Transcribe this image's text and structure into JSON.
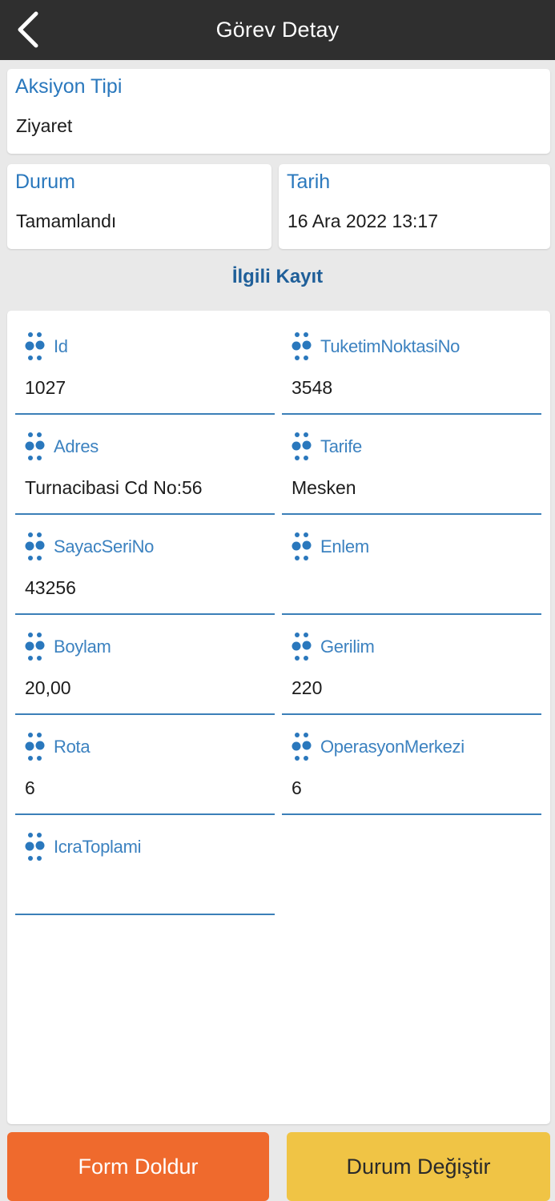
{
  "header": {
    "title": "Görev Detay"
  },
  "aksiyon": {
    "label": "Aksiyon Tipi",
    "value": "Ziyaret"
  },
  "durum": {
    "label": "Durum",
    "value": "Tamamlandı"
  },
  "tarih": {
    "label": "Tarih",
    "value": "16 Ara 2022 13:17"
  },
  "related": {
    "title": "İlgili Kayıt",
    "fields": [
      {
        "label": "Id",
        "value": "1027"
      },
      {
        "label": "TuketimNoktasiNo",
        "value": "3548"
      },
      {
        "label": "Adres",
        "value": "Turnacibasi Cd No:56"
      },
      {
        "label": "Tarife",
        "value": "Mesken"
      },
      {
        "label": "SayacSeriNo",
        "value": "43256"
      },
      {
        "label": "Enlem",
        "value": ""
      },
      {
        "label": "Boylam",
        "value": "20,00"
      },
      {
        "label": "Gerilim",
        "value": "220"
      },
      {
        "label": "Rota",
        "value": "6"
      },
      {
        "label": "OperasyonMerkezi",
        "value": "6"
      },
      {
        "label": "IcraToplami",
        "value": ""
      }
    ]
  },
  "buttons": {
    "form": "Form Doldur",
    "durum": "Durum Değiştir"
  },
  "colors": {
    "header_bg": "#2f2f2f",
    "label_blue": "#2a78bd",
    "orange": "#ef6a2d",
    "yellow": "#f0c445"
  },
  "icons": {
    "back": "chevron-left-icon",
    "field": "dots-icon"
  }
}
